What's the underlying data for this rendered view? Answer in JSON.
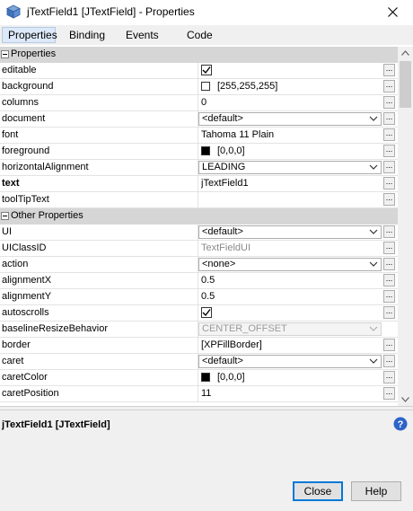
{
  "window": {
    "title": "jTextField1 [JTextField] - Properties"
  },
  "tabs": [
    "Properties",
    "Binding",
    "Events",
    "Code"
  ],
  "sections": {
    "properties": "Properties",
    "other": "Other Properties"
  },
  "props": [
    {
      "name": "editable",
      "type": "check",
      "checked": true,
      "dots": true
    },
    {
      "name": "background",
      "type": "color",
      "color": "#ffffff",
      "value": "[255,255,255]",
      "dots": true
    },
    {
      "name": "columns",
      "type": "text",
      "value": "0",
      "dots": true
    },
    {
      "name": "document",
      "type": "combo",
      "value": "<default>",
      "dots": true
    },
    {
      "name": "font",
      "type": "text",
      "value": "Tahoma 11 Plain",
      "dots": true
    },
    {
      "name": "foreground",
      "type": "color",
      "color": "#000000",
      "value": "[0,0,0]",
      "dots": true
    },
    {
      "name": "horizontalAlignment",
      "type": "combo",
      "value": "LEADING",
      "dots": true
    },
    {
      "name": "text",
      "type": "text",
      "value": "jTextField1",
      "bold": true,
      "dots": true
    },
    {
      "name": "toolTipText",
      "type": "text",
      "value": "",
      "dots": true
    }
  ],
  "other_props": [
    {
      "name": "UI",
      "type": "combo",
      "value": "<default>",
      "dots": true
    },
    {
      "name": "UIClassID",
      "type": "text",
      "value": "TextFieldUI",
      "gray": true,
      "dots": true
    },
    {
      "name": "action",
      "type": "combo",
      "value": "<none>",
      "dots": true
    },
    {
      "name": "alignmentX",
      "type": "text",
      "value": "0.5",
      "dots": true
    },
    {
      "name": "alignmentY",
      "type": "text",
      "value": "0.5",
      "dots": true
    },
    {
      "name": "autoscrolls",
      "type": "check",
      "checked": true,
      "dots": true
    },
    {
      "name": "baselineResizeBehavior",
      "type": "combo",
      "value": "CENTER_OFFSET",
      "disabled": true,
      "dots": false
    },
    {
      "name": "border",
      "type": "text",
      "value": "[XPFillBorder]",
      "dots": true
    },
    {
      "name": "caret",
      "type": "combo",
      "value": "<default>",
      "dots": true
    },
    {
      "name": "caretColor",
      "type": "color",
      "color": "#000000",
      "value": "[0,0,0]",
      "dots": true
    },
    {
      "name": "caretPosition",
      "type": "text",
      "value": "11",
      "dots": true
    }
  ],
  "description": {
    "title": "jTextField1 [JTextField]"
  },
  "buttons": {
    "close": "Close",
    "help": "Help"
  },
  "dots_label": "..."
}
